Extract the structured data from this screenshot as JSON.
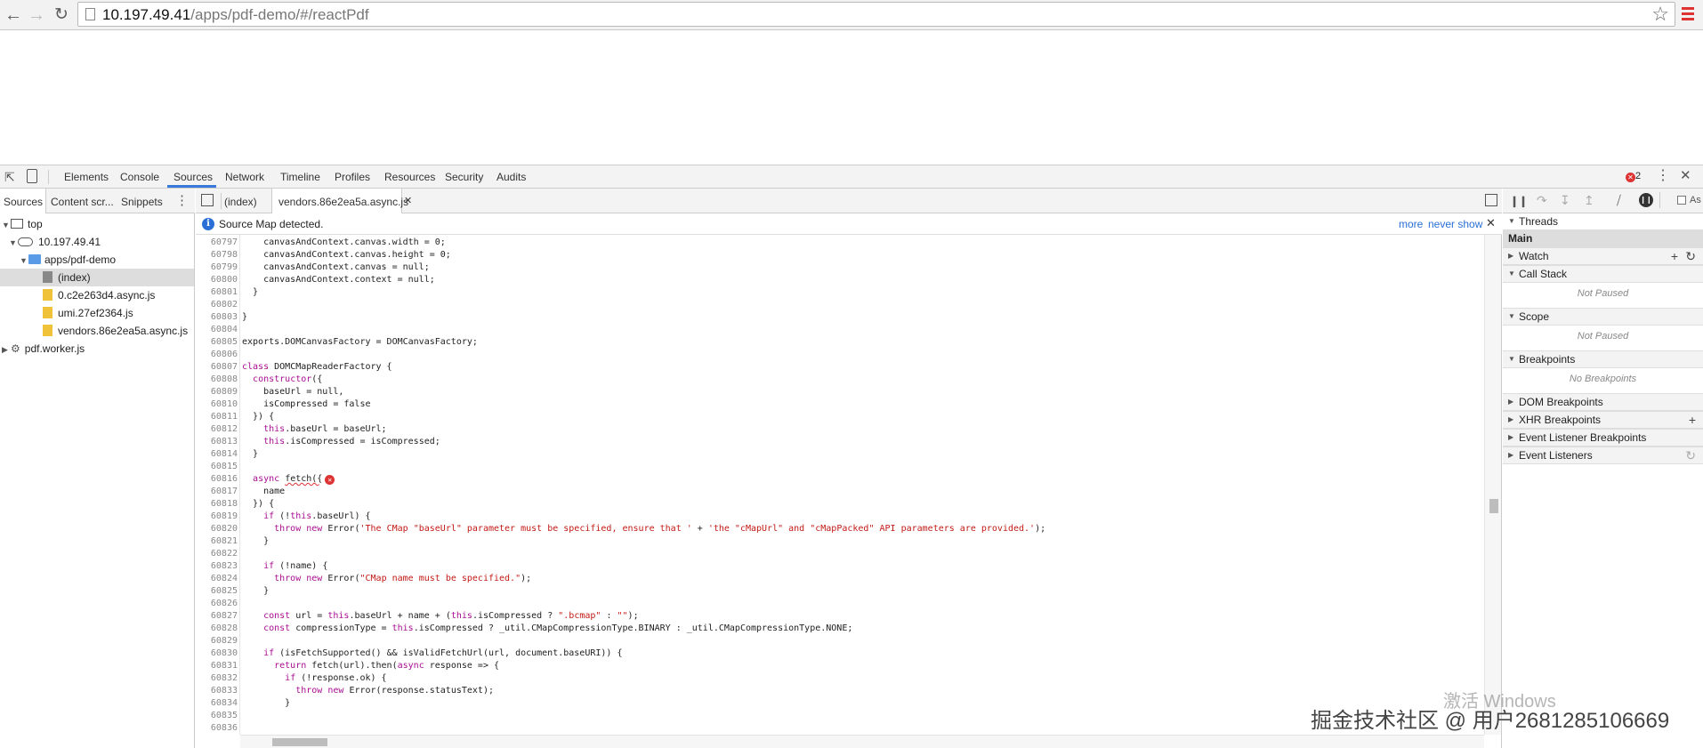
{
  "browser": {
    "url_host": "10.197.49.41",
    "url_path": "/apps/pdf-demo/#/reactPdf"
  },
  "devtools": {
    "tabs": [
      "Elements",
      "Console",
      "Sources",
      "Network",
      "Timeline",
      "Profiles",
      "Resources",
      "Security",
      "Audits"
    ],
    "active_tab": "Sources",
    "error_count": "2"
  },
  "navigator": {
    "tabs": [
      "Sources",
      "Content scr...",
      "Snippets"
    ],
    "tree": [
      {
        "label": "top"
      },
      {
        "label": "10.197.49.41"
      },
      {
        "label": "apps/pdf-demo"
      },
      {
        "label": "(index)"
      },
      {
        "label": "0.c2e263d4.async.js"
      },
      {
        "label": "umi.27ef2364.js"
      },
      {
        "label": "vendors.86e2ea5a.async.js"
      },
      {
        "label": "pdf.worker.js"
      }
    ]
  },
  "editor": {
    "tabs": [
      "(index)",
      "vendors.86e2ea5a.async.js"
    ],
    "infobar": {
      "message": "Source Map detected.",
      "more": "more",
      "never": "never show"
    }
  },
  "code_lines": [
    {
      "n": "60797",
      "t": "    canvasAndContext.canvas.width = 0;"
    },
    {
      "n": "60798",
      "t": "    canvasAndContext.canvas.height = 0;"
    },
    {
      "n": "60799",
      "t": "    canvasAndContext.canvas = null;"
    },
    {
      "n": "60800",
      "t": "    canvasAndContext.context = null;"
    },
    {
      "n": "60801",
      "t": "  }"
    },
    {
      "n": "60802",
      "t": ""
    },
    {
      "n": "60803",
      "t": "}"
    },
    {
      "n": "60804",
      "t": ""
    },
    {
      "n": "60805",
      "t": "exports.DOMCanvasFactory = DOMCanvasFactory;"
    },
    {
      "n": "60806",
      "t": ""
    },
    {
      "n": "60807",
      "t": "class DOMCMapReaderFactory {"
    },
    {
      "n": "60808",
      "t": "  constructor({"
    },
    {
      "n": "60809",
      "t": "    baseUrl = null,"
    },
    {
      "n": "60810",
      "t": "    isCompressed = false"
    },
    {
      "n": "60811",
      "t": "  }) {"
    },
    {
      "n": "60812",
      "t": "    this.baseUrl = baseUrl;"
    },
    {
      "n": "60813",
      "t": "    this.isCompressed = isCompressed;"
    },
    {
      "n": "60814",
      "t": "  }"
    },
    {
      "n": "60815",
      "t": ""
    },
    {
      "n": "60816",
      "t": "  async fetch({"
    },
    {
      "n": "60817",
      "t": "    name"
    },
    {
      "n": "60818",
      "t": "  }) {"
    },
    {
      "n": "60819",
      "t": "    if (!this.baseUrl) {"
    },
    {
      "n": "60820",
      "t": "      throw new Error('The CMap \"baseUrl\" parameter must be specified, ensure that ' + 'the \"cMapUrl\" and \"cMapPacked\" API parameters are provided.');"
    },
    {
      "n": "60821",
      "t": "    }"
    },
    {
      "n": "60822",
      "t": ""
    },
    {
      "n": "60823",
      "t": "    if (!name) {"
    },
    {
      "n": "60824",
      "t": "      throw new Error(\"CMap name must be specified.\");"
    },
    {
      "n": "60825",
      "t": "    }"
    },
    {
      "n": "60826",
      "t": ""
    },
    {
      "n": "60827",
      "t": "    const url = this.baseUrl + name + (this.isCompressed ? \".bcmap\" : \"\");"
    },
    {
      "n": "60828",
      "t": "    const compressionType = this.isCompressed ? _util.CMapCompressionType.BINARY : _util.CMapCompressionType.NONE;"
    },
    {
      "n": "60829",
      "t": ""
    },
    {
      "n": "60830",
      "t": "    if (isFetchSupported() && isValidFetchUrl(url, document.baseURI)) {"
    },
    {
      "n": "60831",
      "t": "      return fetch(url).then(async response => {"
    },
    {
      "n": "60832",
      "t": "        if (!response.ok) {"
    },
    {
      "n": "60833",
      "t": "          throw new Error(response.statusText);"
    },
    {
      "n": "60834",
      "t": "        }"
    },
    {
      "n": "60835",
      "t": ""
    },
    {
      "n": "60836",
      "t": ""
    }
  ],
  "debugger": {
    "threads": "Threads",
    "main": "Main",
    "watch": "Watch",
    "call_stack": "Call Stack",
    "not_paused": "Not Paused",
    "scope": "Scope",
    "breakpoints": "Breakpoints",
    "no_breakpoints": "No Breakpoints",
    "dom_breakpoints": "DOM Breakpoints",
    "xhr_breakpoints": "XHR Breakpoints",
    "event_listener_breakpoints": "Event Listener Breakpoints",
    "event_listeners": "Event Listeners",
    "async_label": "As"
  },
  "watermark": {
    "activate": "激活 Windows",
    "community": "掘金技术社区 @ 用户2681285106669"
  }
}
